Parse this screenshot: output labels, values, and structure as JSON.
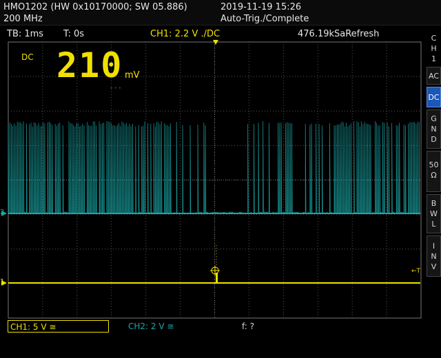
{
  "header": {
    "device": "HMO1202 (HW 0x10170000; SW 05.886)",
    "bandwidth": "200 MHz",
    "datetime": "2019-11-19 15:26",
    "status": "Auto-Trig./Complete"
  },
  "topbar": {
    "timebase": "TB: 1ms",
    "trigger_time": "T: 0s",
    "ch1_setting": "CH1: 2.2 V ./DC",
    "sample_rate": "476.19kSaRefresh"
  },
  "measurement": {
    "coupling": "DC",
    "value": "210",
    "unit": "mV",
    "sub": "- - -"
  },
  "markers": {
    "ch2": "2",
    "ch1": "1",
    "trigger": "←T"
  },
  "side_menu": {
    "title": [
      "C",
      "H",
      "1"
    ],
    "ac": "AC",
    "dc": "DC",
    "gnd": [
      "G",
      "N",
      "D"
    ],
    "ohm": [
      "50",
      "Ω"
    ],
    "bwl": [
      "B",
      "W",
      "L"
    ],
    "inv": [
      "I",
      "N",
      "V"
    ]
  },
  "statusbar": {
    "ch1": "CH1: 5 V ≅",
    "ch2": "CH2: 2 V ≅",
    "freq": "f: ?"
  },
  "colors": {
    "ch1": "#f0e000",
    "ch2": "#1aa8a8",
    "grid": "#5a5a5a",
    "accent": "#1c57b8"
  }
}
